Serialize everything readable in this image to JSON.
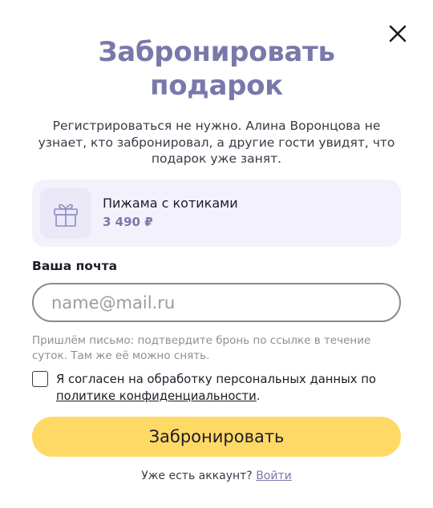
{
  "modal": {
    "title_line1": "Забронировать",
    "title_line2": "подарок",
    "subtitle": "Регистрироваться не нужно. Алина Воронцова не узнает, кто забронировал, а другие гости увидят, что подарок уже занят."
  },
  "gift": {
    "icon": "gift-icon",
    "name": "Пижама с котиками",
    "price": "3 490 ₽"
  },
  "form": {
    "email_label": "Ваша почта",
    "email_placeholder": "name@mail.ru",
    "email_value": "",
    "hint": "Пришлём письмо: подтвердите бронь по ссылке в течение суток. Там же её можно снять.",
    "consent_text": "Я согласен на обработку персональных данных по",
    "consent_link": "политике конфиденциальности",
    "consent_suffix": ".",
    "consent_checked": false,
    "submit_label": "Забронировать"
  },
  "footer": {
    "question": "Уже есть аккаунт?",
    "login_link": "Войти"
  },
  "icons": {
    "close": "close-icon",
    "gift": "gift-icon"
  },
  "colors": {
    "accent": "#7a78aa",
    "button": "#ffd966",
    "card_bg": "#f3f2fc"
  }
}
